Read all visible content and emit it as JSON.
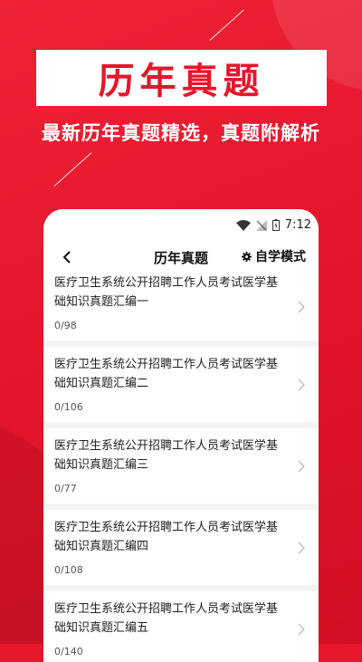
{
  "banner": {
    "title": "历年真题",
    "subtitle": "最新历年真题精选，真题附解析"
  },
  "status": {
    "time": "7:12"
  },
  "appbar": {
    "title": "历年真题",
    "mode_label": "自学模式"
  },
  "items": [
    {
      "title": "医疗卫生系统公开招聘工作人员考试医学基础知识真题汇编一",
      "progress": "0/98"
    },
    {
      "title": "医疗卫生系统公开招聘工作人员考试医学基础知识真题汇编二",
      "progress": "0/106"
    },
    {
      "title": "医疗卫生系统公开招聘工作人员考试医学基础知识真题汇编三",
      "progress": "0/77"
    },
    {
      "title": "医疗卫生系统公开招聘工作人员考试医学基础知识真题汇编四",
      "progress": "0/108"
    },
    {
      "title": "医疗卫生系统公开招聘工作人员考试医学基础知识真题汇编五",
      "progress": "0/140"
    }
  ],
  "colors": {
    "brand_red": "#e5172b",
    "page_bg": "#f4f4f4"
  },
  "icons": [
    "wifi-icon",
    "signal-icon",
    "battery-icon",
    "back-arrow-icon",
    "gear-icon",
    "chevron-right-icon"
  ]
}
